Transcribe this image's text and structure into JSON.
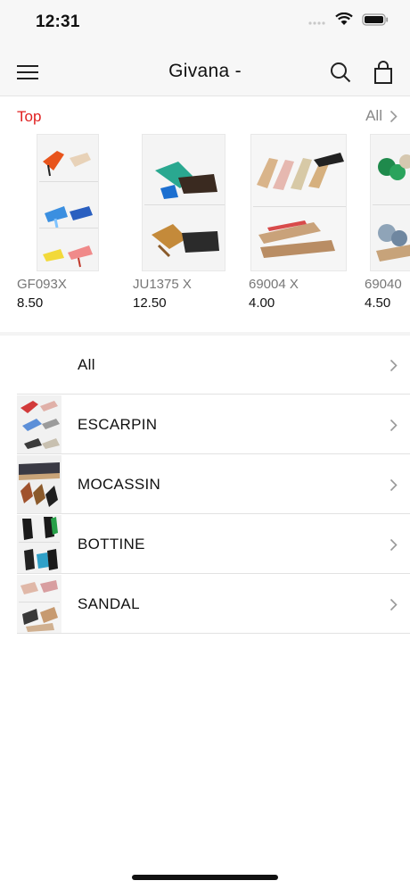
{
  "status_bar": {
    "time": "12:31",
    "icons": [
      "signal-icon",
      "wifi-icon",
      "battery-icon"
    ]
  },
  "nav": {
    "title": "Givana -",
    "icons": [
      "menu-icon",
      "search-icon",
      "bag-icon"
    ]
  },
  "top_section": {
    "title": "Top",
    "all_label": "All",
    "accent_color": "#e02020"
  },
  "products": [
    {
      "name": "GF093X",
      "price": "8.50"
    },
    {
      "name": "JU1375 X",
      "price": "12.50"
    },
    {
      "name": "69004 X",
      "price": "4.00"
    },
    {
      "name": "69040",
      "price": "4.50"
    }
  ],
  "categories": [
    {
      "label": "All"
    },
    {
      "label": "ESCARPIN"
    },
    {
      "label": "MOCASSIN"
    },
    {
      "label": "BOTTINE"
    },
    {
      "label": "SANDAL"
    }
  ]
}
